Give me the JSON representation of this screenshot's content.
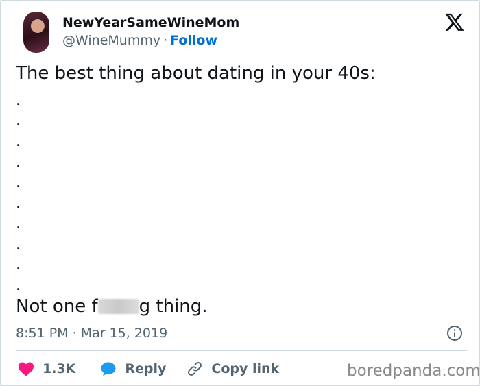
{
  "tweet": {
    "display_name": "NewYearSameWineMom",
    "handle": "@WineMummy",
    "separator": "·",
    "follow_label": "Follow",
    "text_first_line": "The best thing about dating in your 40s:",
    "dots": [
      ".",
      ".",
      ".",
      ".",
      ".",
      ".",
      ".",
      ".",
      ".",
      "."
    ],
    "last_line_prefix": "Not one f",
    "last_line_suffix": "g thing.",
    "time": "8:51 PM",
    "date": "Mar 15, 2019"
  },
  "actions": {
    "like_count": "1.3K",
    "reply_label": "Reply",
    "copy_label": "Copy link"
  },
  "watermark": "boredpanda.com",
  "icons": {
    "brand": "x-logo-icon",
    "like": "heart-icon",
    "reply": "speech-bubble-icon",
    "copy": "link-icon",
    "info": "info-icon"
  },
  "colors": {
    "like": "#f91880",
    "reply": "#1d9bf0",
    "follow": "#006fd6",
    "secondary_text": "#536471"
  }
}
